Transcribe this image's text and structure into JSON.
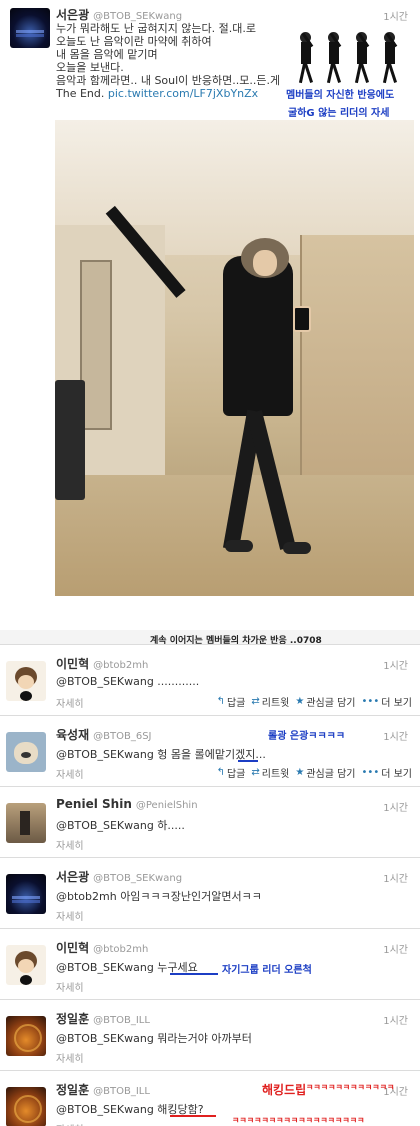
{
  "top_tweet": {
    "name": "서은광",
    "handle": "@BTOB_SEKwang",
    "time": "1시간",
    "lines": [
      "누가 뭐라해도 난 굽혀지지 않는다. 절.대.로",
      "오늘도 난 음악이란 마약에 취하여",
      "내 몸을 음악에 맡기며",
      "오늘을 보낸다.",
      "음악과 함께라면.. 내 Soul이 반응하면..모..든.게"
    ],
    "last_line_prefix": "The End.",
    "link": "pic.twitter.com/LF7jXbYnZx",
    "annotation_1": "멤버들의 자신한 반응에도",
    "annotation_2": "굴하G 않는 리더의 자세"
  },
  "replies_section": {
    "caption": "계속 이어지는 멤버들의 차가운 반응 ..0708",
    "actions": {
      "reply": "답글",
      "retweet": "리트윗",
      "favorite": "관심글 담기",
      "more": "더 보기"
    },
    "detail_label": "자세히",
    "items": [
      {
        "name": "이민혁",
        "handle": "@btob2mh",
        "time": "1시간",
        "text": "@BTOB_SEKwang ............",
        "avatar": "cartoon-avatar"
      },
      {
        "name": "육성재",
        "handle": "@BTOB_6SJ",
        "time": "1시간",
        "text": "@BTOB_SEKwang 헝 몸을 롤에맡기겠지...",
        "avatar": "dog-avatar"
      },
      {
        "name": "Peniel Shin",
        "handle": "@PenielShin",
        "time": "1시간",
        "text": "@BTOB_SEKwang 하.....",
        "avatar": "room-avatar"
      },
      {
        "name": "서은광",
        "handle": "@BTOB_SEKwang",
        "time": "1시간",
        "text": "@btob2mh 아임ㅋㅋㅋ장난인거알면서ㅋㅋ",
        "avatar": "stage-avatar"
      },
      {
        "name": "이민혁",
        "handle": "@btob2mh",
        "time": "1시간",
        "text": "@BTOB_SEKwang 누구세요",
        "avatar": "cartoon-avatar"
      },
      {
        "name": "정일훈",
        "handle": "@BTOB_ILL",
        "time": "1시간",
        "text": "@BTOB_SEKwang 뭐라는거야 아까부터",
        "avatar": "fire-avatar"
      },
      {
        "name": "정일훈",
        "handle": "@BTOB_ILL",
        "time": "1시간",
        "text": "@BTOB_SEKwang 해킹당함?",
        "avatar": "fire-avatar"
      }
    ],
    "annotations": {
      "reply2": "롤광 은광ㅋㅋㅋㅋ",
      "reply5": "자기그룹 리더 오른척",
      "reply7_title": "해킹드립",
      "reply7_line1": "ㅋㅋㅋㅋㅋㅋㅋㅋㅋㅋㅋㅋ",
      "reply7_line2": "ㅋㅋㅋㅋㅋㅋㅋㅋㅋㅋㅋㅋㅋㅋㅋㅋㅋㅋ"
    },
    "colors": {
      "annotation_blue": "#1c3ec4",
      "annotation_red": "#e0201f",
      "link": "#2a7ab0"
    }
  }
}
